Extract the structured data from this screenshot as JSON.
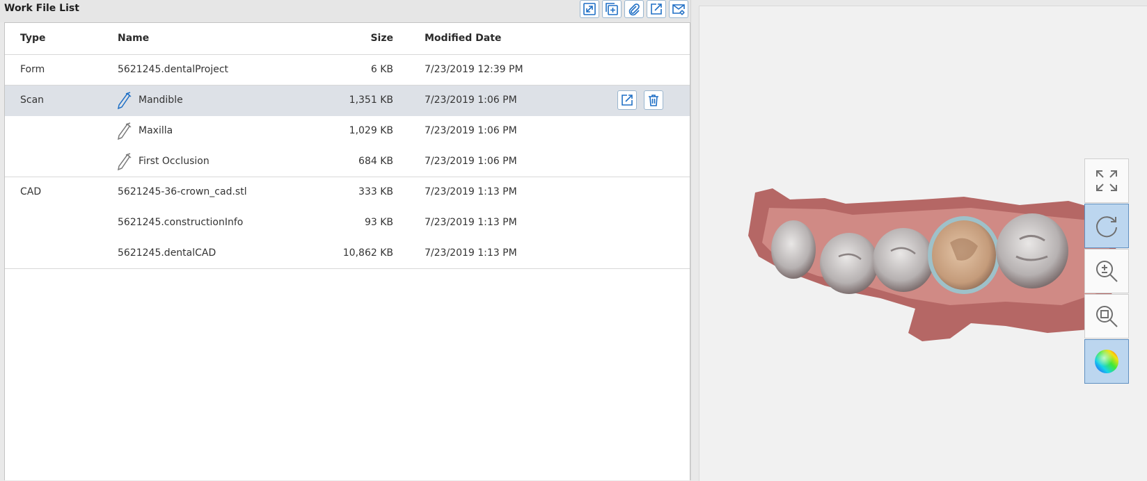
{
  "panel": {
    "title": "Work File List",
    "header_buttons": [
      {
        "name": "expand-icon"
      },
      {
        "name": "add-file-icon"
      },
      {
        "name": "attach-icon"
      },
      {
        "name": "export-icon"
      },
      {
        "name": "mail-settings-icon"
      }
    ]
  },
  "table": {
    "columns": {
      "type": "Type",
      "name": "Name",
      "size": "Size",
      "date": "Modified Date"
    },
    "rows": [
      {
        "type": "Form",
        "name": "5621245.dentalProject",
        "size": "6 KB",
        "date": "7/23/2019 12:39 PM",
        "icon": "",
        "selected": false
      },
      {
        "type": "Scan",
        "name": "Mandible",
        "size": "1,351 KB",
        "date": "7/23/2019 1:06 PM",
        "icon": "scanner-icon",
        "selected": true
      },
      {
        "type": "",
        "name": "Maxilla",
        "size": "1,029 KB",
        "date": "7/23/2019 1:06 PM",
        "icon": "scanner-icon",
        "selected": false
      },
      {
        "type": "",
        "name": "First Occlusion",
        "size": "684 KB",
        "date": "7/23/2019 1:06 PM",
        "icon": "scanner-icon",
        "selected": false
      },
      {
        "type": "CAD",
        "name": "5621245-36-crown_cad.stl",
        "size": "333 KB",
        "date": "7/23/2019 1:13 PM",
        "icon": "",
        "selected": false
      },
      {
        "type": "",
        "name": "5621245.constructionInfo",
        "size": "93 KB",
        "date": "7/23/2019 1:13 PM",
        "icon": "",
        "selected": false
      },
      {
        "type": "",
        "name": "5621245.dentalCAD",
        "size": "10,862 KB",
        "date": "7/23/2019 1:13 PM",
        "icon": "",
        "selected": false
      }
    ],
    "row_actions": [
      "export-icon",
      "trash-icon"
    ]
  },
  "viewer": {
    "tools": [
      {
        "name": "fit-to-screen-icon",
        "active": false
      },
      {
        "name": "rotate-icon",
        "active": true
      },
      {
        "name": "zoom-in-out-icon",
        "active": false
      },
      {
        "name": "zoom-fit-icon",
        "active": false
      },
      {
        "name": "color-map-icon",
        "active": true
      }
    ]
  },
  "colors": {
    "accent": "#1f6fc5",
    "selection": "#dde1e7",
    "active_tool": "#bcd6ef"
  }
}
